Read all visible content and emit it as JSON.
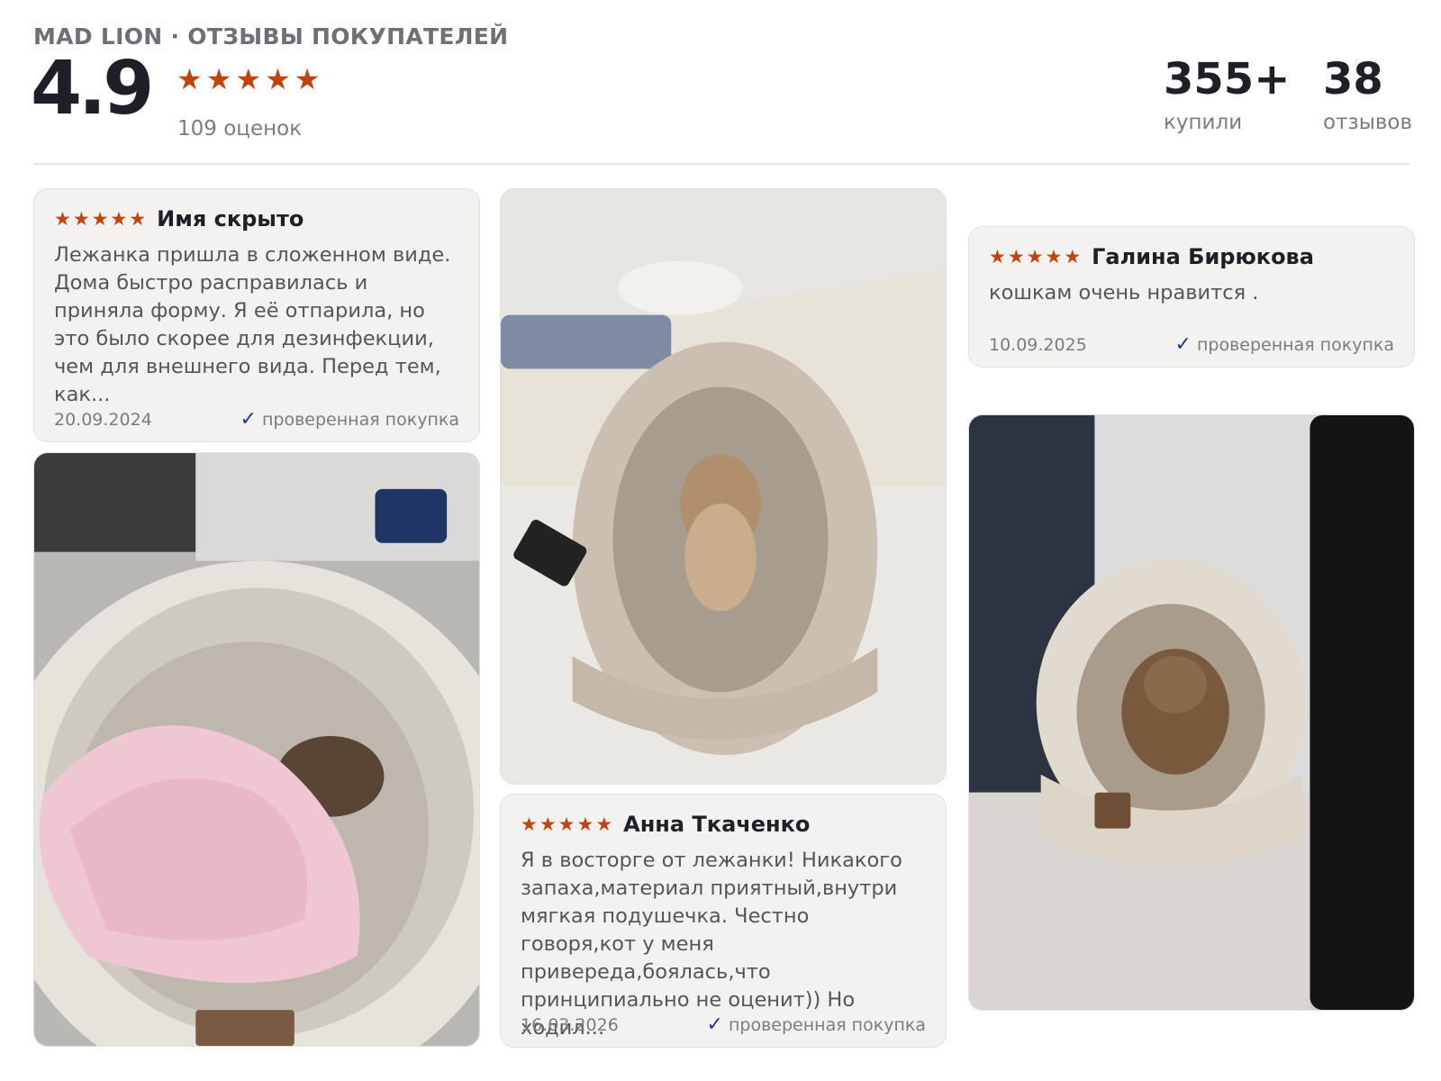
{
  "header": {
    "brand": "MAD LION · ОТЗЫВЫ ПОКУПАТЕЛЕЙ",
    "rating": "4.9",
    "rating_stars": 5,
    "ratings_count": "109 оценок",
    "bought_value": "355+",
    "bought_label": "купили",
    "reviews_value": "38",
    "reviews_label": "отзывов"
  },
  "reviews": [
    {
      "stars": 5,
      "author": "Имя скрыто",
      "text": "Лежанка пришла в сложенном виде. Дома быстро расправилась и приняла форму. Я её отпарила, но это было скорее для дезинфекции, чем для внешнего вида. Перед тем, как...",
      "date": "20.09.2024",
      "verified": "проверенная покупка"
    },
    {
      "stars": 5,
      "author": "Анна Ткаченко",
      "text": "Я в восторге от лежанки! Никакого запаха,материал приятный,внутри мягкая подушечка. Честно говоря,кот у меня привереда,боялась,что принципиально не оценит)) Но ходил...",
      "date": "16.03.2026",
      "verified": "проверенная покупка"
    },
    {
      "stars": 5,
      "author": "Галина Бирюкова",
      "text": "кошкам очень нравится .",
      "date": "10.09.2025",
      "verified": "проверенная покупка"
    }
  ],
  "icons": {
    "star": "star-icon",
    "check": "checkmark-icon"
  },
  "colors": {
    "star": "#c1440e",
    "check": "#1f3b86",
    "card_bg": "#f3f2f0"
  }
}
